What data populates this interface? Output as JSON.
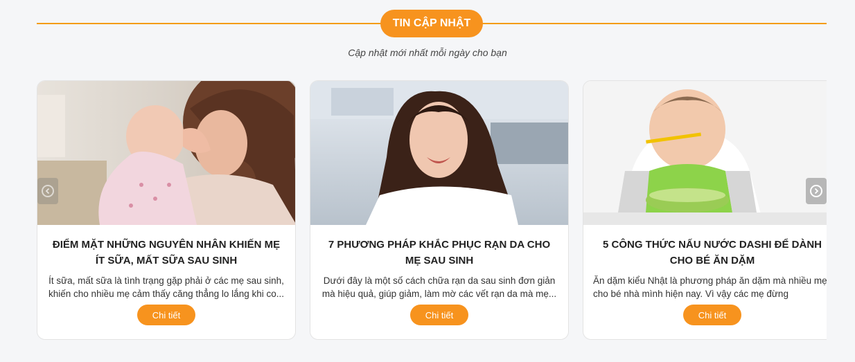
{
  "section": {
    "title": "TIN CẬP NHẬT",
    "subtitle": "Cập nhật mới nhất mỗi ngày cho bạn",
    "accent_color": "#f7931e"
  },
  "carousel": {
    "prev_icon": "chevron-left-icon",
    "next_icon": "chevron-right-icon",
    "cards": [
      {
        "title": "ĐIỂM MẶT NHỮNG NGUYÊN NHÂN KHIẾN MẸ ÍT SỮA, MẤT SỮA SAU SINH",
        "excerpt": "Ít sữa, mất sữa là tình trạng gặp phải ở các mẹ sau sinh, khiến cho nhiều mẹ cảm thấy căng thẳng lo lắng khi co...",
        "button_label": "Chi tiết",
        "image": "mother-holding-baby-photo"
      },
      {
        "title": "7 PHƯƠNG PHÁP KHẮC PHỤC RẠN DA CHO MẸ SAU SINH",
        "excerpt": "Dưới đây là một số cách chữa rạn da sau sinh đơn giản mà hiệu quả, giúp giảm, làm mờ các vết rạn da mà mẹ...",
        "button_label": "Chi tiết",
        "image": "smiling-woman-photo"
      },
      {
        "title": "5 CÔNG THỨC NẤU NƯỚC DASHI ĐỂ DÀNH CHO BÉ ĂN DẶM",
        "excerpt": "Ăn dặm kiểu Nhật là phương pháp ăn dặm mà nhiều mẹ lựa chọn cho bé nhà mình hiện nay. Vì vậy các mẹ đừng",
        "button_label": "Chi tiết",
        "image": "baby-eating-photo"
      }
    ]
  }
}
